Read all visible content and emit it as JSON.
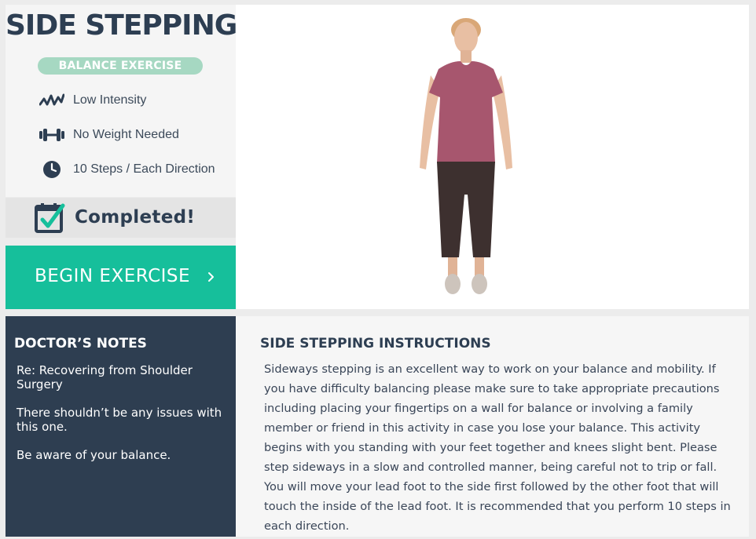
{
  "exercise": {
    "title": "SIDE STEPPING",
    "category_badge": "BALANCE EXERCISE",
    "meta": [
      {
        "icon": "intensity-wave-icon",
        "text": "Low Intensity"
      },
      {
        "icon": "dumbbell-icon",
        "text": "No Weight Needed"
      },
      {
        "icon": "clock-icon",
        "text": "10 Steps / Each Direction"
      }
    ],
    "status": {
      "icon": "calendar-check-icon",
      "text": "Completed!"
    },
    "begin_button": {
      "label": "BEGIN EXERCISE",
      "icon": "chevron-right-icon"
    }
  },
  "video": {
    "subject": "exercise-demo-figure"
  },
  "doctors_notes": {
    "title": "DOCTOR’S NOTES",
    "items": [
      "Re: Recovering from Shoulder Surgery",
      "There shouldn’t be any issues with this one.",
      "Be aware of your balance."
    ]
  },
  "instructions": {
    "title": "SIDE STEPPING INSTRUCTIONS",
    "body": "Sideways stepping is an excellent way to work on your balance and mobility. If you have difficulty balancing please make sure to take appropriate precautions including placing your fingertips on a wall for balance or involving a family member or friend in this activity in case you lose your balance. This activity begins with you standing with your feet together and knees slight bent. Please step sideways in a slow and controlled manner, being careful not to trip or fall. You will move your lead foot to the side first followed by the other foot that will touch the inside of the lead foot. It is recommended that you perform 10 steps in each direction."
  },
  "colors": {
    "accent": "#16bf9b",
    "badge": "#a6d8c2",
    "navy": "#2e3e51",
    "check": "#16bf9b"
  }
}
